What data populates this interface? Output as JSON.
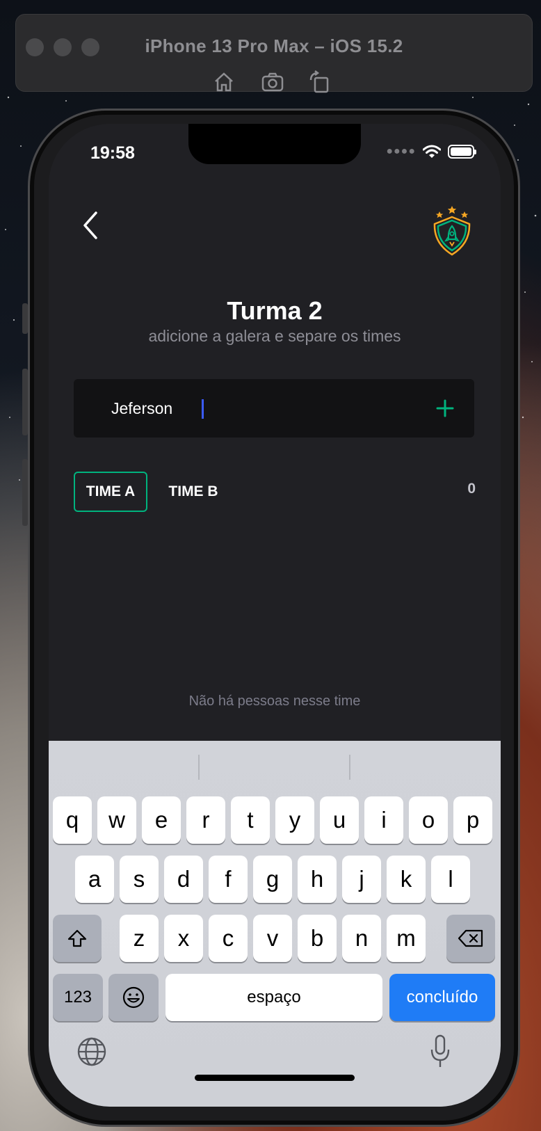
{
  "simulator": {
    "title": "iPhone 13 Pro Max – iOS 15.2",
    "toolbar_icons": [
      "home-icon",
      "screenshot-icon",
      "rotate-icon"
    ]
  },
  "status_bar": {
    "time": "19:58",
    "icons": [
      "cellular-icon",
      "wifi-icon",
      "battery-icon"
    ]
  },
  "header": {
    "back_icon": "chevron-left-icon",
    "logo": "shield-rocket-logo"
  },
  "page": {
    "title": "Turma 2",
    "subtitle": "adicione a galera e separe os times"
  },
  "participant_input": {
    "value": "Jeferson",
    "add_icon": "plus-icon"
  },
  "teams": {
    "tabs": [
      {
        "label": "TIME A",
        "active": true
      },
      {
        "label": "TIME B",
        "active": false
      }
    ],
    "count": "0"
  },
  "empty_message": "Não há pessoas nesse time",
  "keyboard": {
    "row1": [
      "q",
      "w",
      "e",
      "r",
      "t",
      "y",
      "u",
      "i",
      "o",
      "p"
    ],
    "row2": [
      "a",
      "s",
      "d",
      "f",
      "g",
      "h",
      "j",
      "k",
      "l"
    ],
    "row3": [
      "z",
      "x",
      "c",
      "v",
      "b",
      "n",
      "m"
    ],
    "numbers_key": "123",
    "space_key": "espaço",
    "done_key": "concluído",
    "icons": [
      "shift-icon",
      "delete-icon",
      "emoji-icon",
      "globe-icon",
      "microphone-icon"
    ]
  },
  "colors": {
    "background": "#202024",
    "input_bg": "#121214",
    "accent_green": "#00b37e",
    "logo_orange": "#f5a623",
    "keyboard_blue": "#1f7cf6"
  }
}
